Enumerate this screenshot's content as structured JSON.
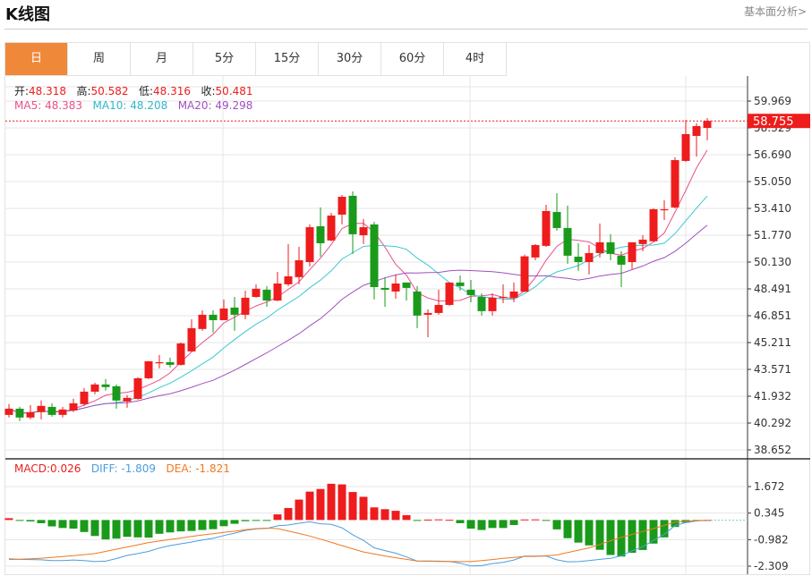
{
  "header": {
    "title": "K线图",
    "link": "基本面分析>"
  },
  "tabs": [
    {
      "label": "日",
      "active": true
    },
    {
      "label": "周"
    },
    {
      "label": "月"
    },
    {
      "label": "5分"
    },
    {
      "label": "15分"
    },
    {
      "label": "30分"
    },
    {
      "label": "60分"
    },
    {
      "label": "4时"
    }
  ],
  "info": {
    "open_label": "开:",
    "open": "48.318",
    "high_label": "高:",
    "high": "50.582",
    "low_label": "低:",
    "low": "48.316",
    "close_label": "收:",
    "close": "50.481",
    "ma5_label": "MA5:",
    "ma5": "48.383",
    "ma10_label": "MA10:",
    "ma10": "48.208",
    "ma20_label": "MA20:",
    "ma20": "49.298",
    "macd_label": "MACD:",
    "macd": "0.026",
    "diff_label": "DIFF:",
    "diff": "-1.809",
    "dea_label": "DEA:",
    "dea": "-1.821"
  },
  "colors": {
    "up": "#ee1c1c",
    "down": "#1a9a1a",
    "ma5": "#e8508a",
    "ma10": "#3cc8d0",
    "ma20": "#a050c0",
    "diff": "#4a9ee0",
    "dea": "#f07820",
    "accent": "#f0883a"
  },
  "chart_data": [
    {
      "type": "candlestick",
      "price_ticks": [
        "59.969",
        "58.329",
        "56.690",
        "55.050",
        "53.410",
        "51.770",
        "50.130",
        "48.491",
        "46.851",
        "45.211",
        "43.571",
        "41.932",
        "40.292",
        "38.652"
      ],
      "ylim": [
        38.652,
        59.969
      ],
      "last_price": "58.755",
      "grid": true,
      "ohlc": [
        [
          40.79,
          41.45,
          40.63,
          41.17
        ],
        [
          41.17,
          41.28,
          40.41,
          40.63
        ],
        [
          40.63,
          41.39,
          40.52,
          40.96
        ],
        [
          40.96,
          41.67,
          40.52,
          41.34
        ],
        [
          41.28,
          41.5,
          40.68,
          40.79
        ],
        [
          40.79,
          41.28,
          40.63,
          41.12
        ],
        [
          41.06,
          41.78,
          40.96,
          41.5
        ],
        [
          41.45,
          42.43,
          41.34,
          42.21
        ],
        [
          42.21,
          42.76,
          42.05,
          42.65
        ],
        [
          42.65,
          42.98,
          42.27,
          42.49
        ],
        [
          42.54,
          42.65,
          41.17,
          41.67
        ],
        [
          41.61,
          42.0,
          41.23,
          41.83
        ],
        [
          41.77,
          43.09,
          41.72,
          43.03
        ],
        [
          43.03,
          44.07,
          42.98,
          44.07
        ],
        [
          43.96,
          44.45,
          43.63,
          44.01
        ],
        [
          44.01,
          44.29,
          43.69,
          43.85
        ],
        [
          43.85,
          45.22,
          43.8,
          45.16
        ],
        [
          44.67,
          46.64,
          44.67,
          46.09
        ],
        [
          46.04,
          47.18,
          45.93,
          46.91
        ],
        [
          46.91,
          47.18,
          45.82,
          46.58
        ],
        [
          46.58,
          47.84,
          46.58,
          47.29
        ],
        [
          47.35,
          48.0,
          45.93,
          46.91
        ],
        [
          46.91,
          48.39,
          46.64,
          47.95
        ],
        [
          48.0,
          48.77,
          47.95,
          48.5
        ],
        [
          48.44,
          48.66,
          47.4,
          47.78
        ],
        [
          47.78,
          49.53,
          47.73,
          48.82
        ],
        [
          48.77,
          51.23,
          48.66,
          49.26
        ],
        [
          49.21,
          51.06,
          48.77,
          50.24
        ],
        [
          50.13,
          52.43,
          49.86,
          52.26
        ],
        [
          52.32,
          53.47,
          50.46,
          51.28
        ],
        [
          51.45,
          53.14,
          51.4,
          52.97
        ],
        [
          53.03,
          54.23,
          52.43,
          54.12
        ],
        [
          54.18,
          54.45,
          50.63,
          51.83
        ],
        [
          51.77,
          52.76,
          51.23,
          52.26
        ],
        [
          52.43,
          52.59,
          47.84,
          48.6
        ],
        [
          48.55,
          49.21,
          47.4,
          48.44
        ],
        [
          48.33,
          49.37,
          47.89,
          48.82
        ],
        [
          48.88,
          48.88,
          47.78,
          48.55
        ],
        [
          48.33,
          48.66,
          46.09,
          46.86
        ],
        [
          46.91,
          47.24,
          45.54,
          47.02
        ],
        [
          47.02,
          48.44,
          46.91,
          47.51
        ],
        [
          47.51,
          48.88,
          47.46,
          48.88
        ],
        [
          48.88,
          49.31,
          48.39,
          48.66
        ],
        [
          48.44,
          49.04,
          47.67,
          48.11
        ],
        [
          48.0,
          48.22,
          46.86,
          47.13
        ],
        [
          47.13,
          48.22,
          46.86,
          47.95
        ],
        [
          47.95,
          48.77,
          47.62,
          48.0
        ],
        [
          47.95,
          48.88,
          47.67,
          48.33
        ],
        [
          48.318,
          50.582,
          48.316,
          50.481
        ],
        [
          50.41,
          51.23,
          50.24,
          51.17
        ],
        [
          51.12,
          53.63,
          51.06,
          53.25
        ],
        [
          53.19,
          54.34,
          52.05,
          52.21
        ],
        [
          52.21,
          53.58,
          50.03,
          50.52
        ],
        [
          50.46,
          51.28,
          49.59,
          50.13
        ],
        [
          50.13,
          51.17,
          49.37,
          50.68
        ],
        [
          50.68,
          52.49,
          50.41,
          51.34
        ],
        [
          51.34,
          51.83,
          50.24,
          50.63
        ],
        [
          50.52,
          50.79,
          48.6,
          49.97
        ],
        [
          50.13,
          51.34,
          49.7,
          51.34
        ],
        [
          51.23,
          51.77,
          50.79,
          51.5
        ],
        [
          51.4,
          53.41,
          51.34,
          53.36
        ],
        [
          53.3,
          53.9,
          52.7,
          53.36
        ],
        [
          53.47,
          56.53,
          53.41,
          56.36
        ],
        [
          56.31,
          58.82,
          56.25,
          57.95
        ],
        [
          57.84,
          58.6,
          56.58,
          58.44
        ],
        [
          58.33,
          58.93,
          57.57,
          58.755
        ]
      ],
      "ma_periods": [
        5,
        10,
        20
      ]
    },
    {
      "type": "bar+line",
      "ticks": [
        "1.672",
        "0.345",
        "-0.982",
        "-2.309"
      ],
      "ylim": [
        -2.45,
        2.0
      ],
      "macd": [
        0.09,
        -0.02,
        -0.07,
        -0.16,
        -0.32,
        -0.4,
        -0.43,
        -0.6,
        -0.8,
        -0.97,
        -0.93,
        -0.84,
        -0.87,
        -0.88,
        -0.69,
        -0.62,
        -0.57,
        -0.55,
        -0.5,
        -0.46,
        -0.31,
        -0.19,
        -0.06,
        -0.03,
        -0.01,
        0.28,
        0.6,
        1.02,
        1.42,
        1.55,
        1.81,
        1.78,
        1.4,
        1.16,
        0.63,
        0.54,
        0.46,
        0.24,
        -0.01,
        0.02,
        0.03,
        0.01,
        -0.16,
        -0.43,
        -0.5,
        -0.4,
        -0.4,
        -0.25,
        0.026,
        0.03,
        -0.01,
        -0.47,
        -0.91,
        -1.13,
        -1.27,
        -1.49,
        -1.75,
        -1.83,
        -1.64,
        -1.5,
        -1.18,
        -0.87,
        -0.35,
        -0.13,
        -0.03,
        0.0
      ],
      "dea": [
        -1.98,
        -1.96,
        -1.94,
        -1.91,
        -1.87,
        -1.83,
        -1.78,
        -1.73,
        -1.68,
        -1.57,
        -1.46,
        -1.35,
        -1.24,
        -1.13,
        -1.05,
        -0.97,
        -0.9,
        -0.82,
        -0.75,
        -0.69,
        -0.62,
        -0.56,
        -0.49,
        -0.43,
        -0.41,
        -0.43,
        -0.55,
        -0.67,
        -0.8,
        -0.96,
        -1.12,
        -1.28,
        -1.44,
        -1.6,
        -1.7,
        -1.8,
        -1.89,
        -1.97,
        -2.05,
        -2.06,
        -2.07,
        -2.07,
        -2.08,
        -2.08,
        -2.03,
        -1.98,
        -1.92,
        -1.87,
        -1.821,
        -1.82,
        -1.79,
        -1.75,
        -1.63,
        -1.51,
        -1.39,
        -1.22,
        -1.04,
        -0.87,
        -0.72,
        -0.58,
        -0.43,
        -0.27,
        -0.1,
        -0.06,
        -0.03,
        -0.01
      ],
      "diff": [
        -1.94,
        -1.97,
        -1.98,
        -1.99,
        -2.03,
        -2.03,
        -2.0,
        -2.03,
        -2.08,
        -2.06,
        -1.93,
        -1.77,
        -1.68,
        -1.57,
        -1.4,
        -1.28,
        -1.19,
        -1.1,
        -1.0,
        -0.92,
        -0.78,
        -0.66,
        -0.52,
        -0.45,
        -0.42,
        -0.29,
        -0.25,
        -0.16,
        -0.09,
        -0.19,
        -0.22,
        -0.39,
        -0.74,
        -1.02,
        -1.39,
        -1.53,
        -1.66,
        -1.85,
        -2.06,
        -2.05,
        -2.06,
        -2.07,
        -2.16,
        -2.3,
        -2.28,
        -2.18,
        -2.12,
        -2.0,
        -1.809,
        -1.81,
        -1.8,
        -1.99,
        -2.09,
        -2.08,
        -2.03,
        -1.97,
        -1.92,
        -1.79,
        -1.54,
        -1.33,
        -1.02,
        -0.71,
        -0.28,
        -0.13,
        -0.05,
        -0.01
      ]
    }
  ]
}
